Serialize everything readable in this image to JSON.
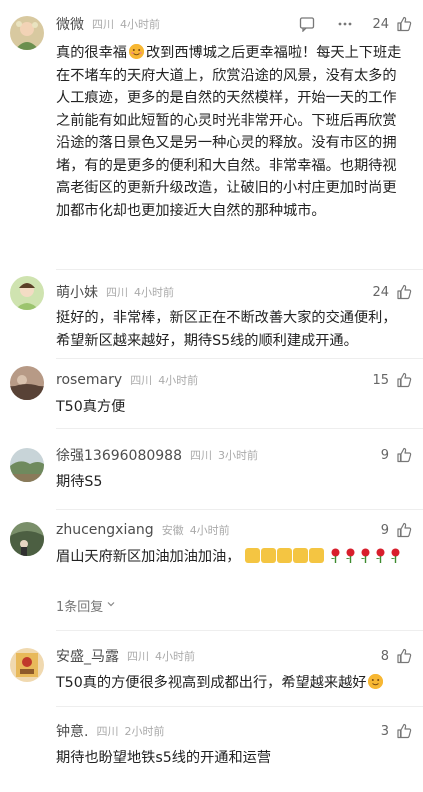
{
  "comments": [
    {
      "username": "微微",
      "location": "四川",
      "time": "4小时前",
      "likes": "24",
      "text_before": "真的很幸福",
      "text_after": "改到西博城之后更幸福啦！每天上下班走在不堵车的天府大道上，欣赏沿途的风景，没有太多的人工痕迹，更多的是自然的天然模样，开始一天的工作之前能有如此短暂的心灵时光非常开心。下班后再欣赏沿途的落日景色又是另一种心灵的释放。没有市区的拥堵，有的是更多的便利和大自然。非常幸福。也期待视高老街区的更新升级改造，让破旧的小村庄更加时尚更加都市化却也更加接近大自然的那种城市。"
    },
    {
      "username": "萌小妹",
      "location": "四川",
      "time": "4小时前",
      "likes": "24",
      "text": "挺好的，非常棒，新区正在不断改善大家的交通便利，希望新区越来越好，期待S5线的顺利建成开通。"
    },
    {
      "username": "rosemary",
      "location": "四川",
      "time": "4小时前",
      "likes": "15",
      "text": "T50真方便"
    },
    {
      "username": "徐强13696080988",
      "location": "四川",
      "time": "3小时前",
      "likes": "9",
      "text": "期待S5"
    },
    {
      "username": "zhucengxiang",
      "location": "安徽",
      "time": "4小时前",
      "likes": "9",
      "text": "眉山天府新区加油加油加油，",
      "reply_toggle": "1条回复"
    },
    {
      "username": "安盛_马露",
      "location": "四川",
      "time": "4小时前",
      "likes": "8",
      "text": "T50真的方便很多视高到成都出行，希望越来越好"
    },
    {
      "username": "钟意.",
      "location": "四川",
      "time": "2小时前",
      "likes": "3",
      "text": "期待也盼望地铁s5线的开通和运营"
    }
  ],
  "icons": {
    "comment": "comment-icon",
    "more": "more-icon",
    "like": "thumbs-up-icon",
    "expand": "chevron-down-icon"
  },
  "colors": {
    "username": "#4d4d4d",
    "meta": "#aaaaaa",
    "text": "#222222",
    "divider": "#eeeeee"
  }
}
